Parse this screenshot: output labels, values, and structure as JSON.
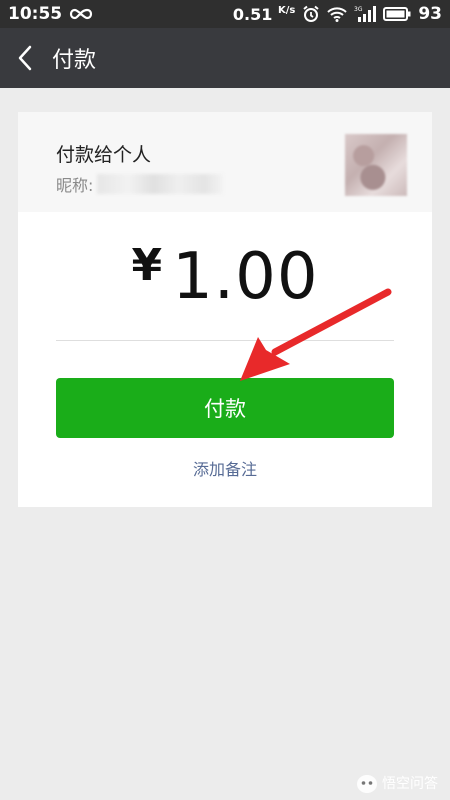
{
  "status_bar": {
    "time": "10:55",
    "infinity_icon": "infinity-icon",
    "net_speed": "0.51",
    "net_unit": "K/s",
    "network_type": "3G",
    "battery_pct": "93"
  },
  "header": {
    "back_icon": "chevron-left-icon",
    "title": "付款"
  },
  "recipient": {
    "title": "付款给个人",
    "nickname_label": "昵称:",
    "nickname_value": ""
  },
  "payment": {
    "currency_symbol": "¥",
    "amount": "1.00",
    "pay_button_label": "付款",
    "add_note_label": "添加备注"
  },
  "colors": {
    "primary_green": "#1aad19",
    "link_blue": "#576b95",
    "header_bg": "#393a3e",
    "annotation_red": "#e8292a"
  },
  "watermark": {
    "text": "悟空问答"
  }
}
